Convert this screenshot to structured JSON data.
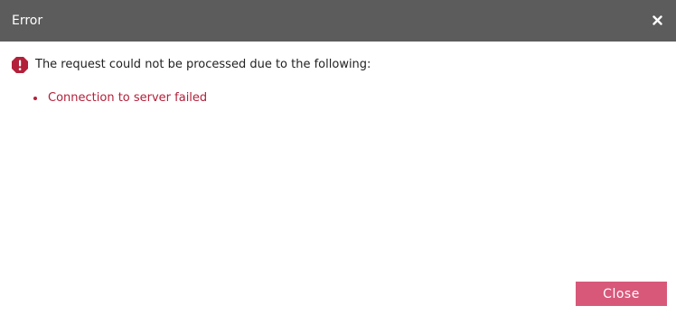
{
  "dialog": {
    "title": "Error",
    "close_icon": "close-icon",
    "alert_icon": "alert-octagon-icon",
    "message": "The request could not be processed due to the following:",
    "errors": [
      "Connection to server failed"
    ],
    "close_label": "Close"
  },
  "colors": {
    "titlebar": "#5c5c5c",
    "error": "#b3203a",
    "button": "#d8587a"
  }
}
